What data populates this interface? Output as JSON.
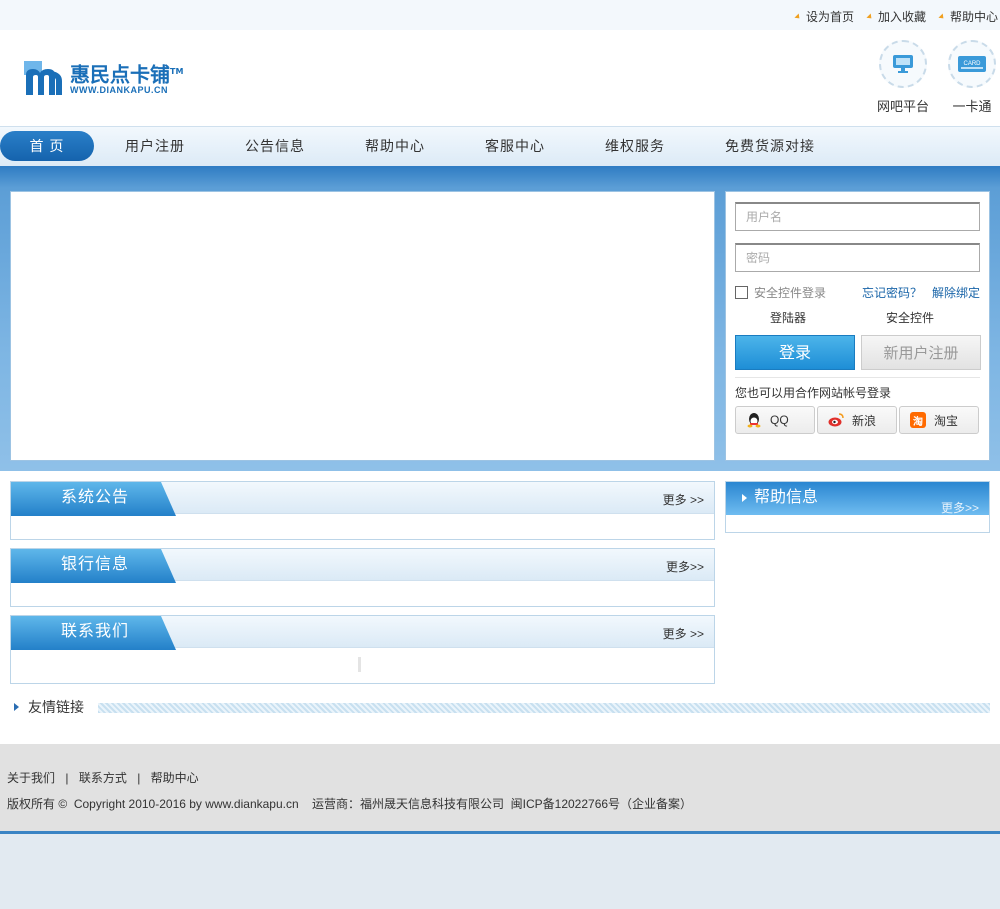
{
  "toplinks": [
    "设为首页",
    "加入收藏",
    "帮助中心"
  ],
  "logo": {
    "cn": "惠民点卡铺",
    "tm": "TM",
    "en": "WWW.DIANKAPU.CN",
    "mark_letter": "m"
  },
  "header_icons": [
    {
      "label": "网吧平台",
      "icon": "monitor-icon"
    },
    {
      "label": "一卡通",
      "icon": "card-icon",
      "icon_text": "CARD"
    }
  ],
  "nav": [
    "首 页",
    "用户注册",
    "公告信息",
    "帮助中心",
    "客服中心",
    "维权服务",
    "免费货源对接"
  ],
  "login": {
    "username_placeholder": "用户名",
    "password_placeholder": "密码",
    "secure_login": "安全控件登录",
    "forgot": "忘记密码？",
    "unbind": "解除绑定",
    "launcher": "登陆器",
    "secure_ctrl": "安全控件",
    "login_btn": "登录",
    "register_btn": "新用户注册",
    "partner_text": "您也可以用合作网站帐号登录",
    "partners": [
      {
        "label": "QQ",
        "icon": "qq-icon",
        "color": "#333333"
      },
      {
        "label": "新浪",
        "icon": "weibo-icon",
        "color": "#e0302b"
      },
      {
        "label": "淘宝",
        "icon": "taobao-icon",
        "color": "#ff6a00",
        "glyph": "淘"
      }
    ]
  },
  "panels": [
    {
      "title": "系统公告",
      "more": "更多 >>"
    },
    {
      "title": "银行信息",
      "more": "更多>>"
    },
    {
      "title": "联系我们",
      "more": "更多 >>"
    }
  ],
  "help": {
    "title": "帮助信息",
    "more": "更多>>"
  },
  "friend_links": "友情链接",
  "footer": {
    "links": [
      "关于我们",
      "联系方式",
      "帮助中心"
    ],
    "separator": "|",
    "copyright": "版权所有 ©  Copyright 2010-2016 by www.diankapu.cn    运营商：福州晟天信息科技有限公司  闽ICP备12022766号（企业备案）"
  },
  "colors": {
    "brand": "#1a6fb8",
    "nav_active": "#1563ad",
    "accent": "#2380c9"
  }
}
